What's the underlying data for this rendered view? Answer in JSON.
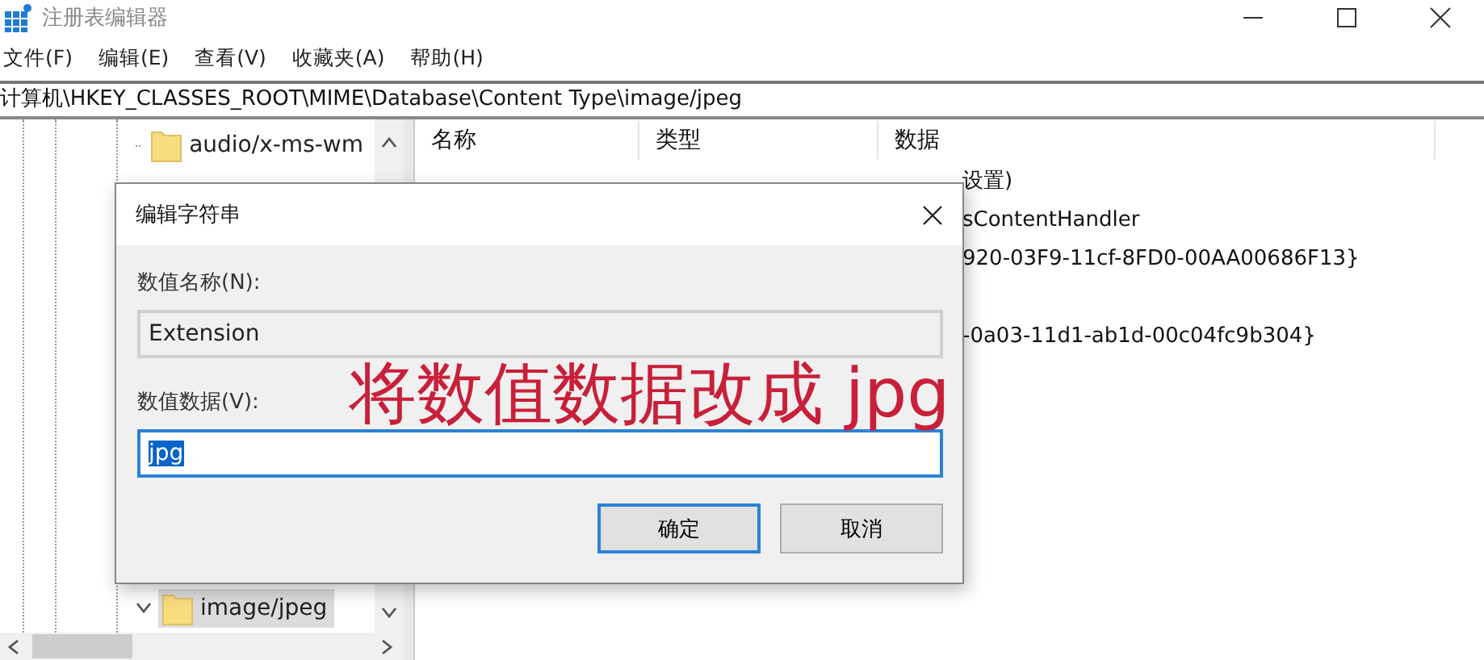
{
  "window": {
    "title": "注册表编辑器"
  },
  "menu": [
    {
      "label": "文件(F)"
    },
    {
      "label": "编辑(E)"
    },
    {
      "label": "查看(V)"
    },
    {
      "label": "收藏夹(A)"
    },
    {
      "label": "帮助(H)"
    }
  ],
  "address": "计算机\\HKEY_CLASSES_ROOT\\MIME\\Database\\Content Type\\image/jpeg",
  "tree": {
    "items": [
      {
        "label": "audio/x-ms-wm",
        "selected": false,
        "expanded": false
      },
      {
        "label": "image/jpeg",
        "selected": true,
        "expanded": true
      }
    ]
  },
  "list": {
    "columns": [
      "名称",
      "类型",
      "数据"
    ],
    "rows": [
      {
        "data": "设置)"
      },
      {
        "data": "sContentHandler"
      },
      {
        "data": "920-03F9-11cf-8FD0-00AA00686F13}"
      },
      {
        "data": ""
      },
      {
        "data": "-0a03-11d1-ab1d-00c04fc9b304}"
      }
    ]
  },
  "dialog": {
    "title": "编辑字符串",
    "name_label": "数值名称(N):",
    "name_value": "Extension",
    "data_label": "数值数据(V):",
    "data_value": "jpg",
    "data_value_selected": true,
    "buttons": [
      {
        "label": "确定",
        "default": true
      },
      {
        "label": "取消",
        "default": false
      }
    ]
  },
  "annotation": "将数值数据改成 jpg"
}
